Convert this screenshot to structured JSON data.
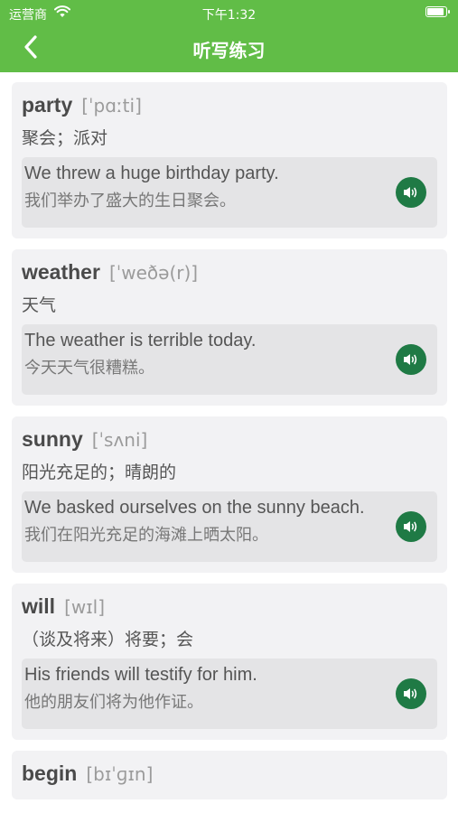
{
  "status": {
    "carrier": "运营商",
    "time": "下午1:32"
  },
  "header": {
    "title": "听写练习"
  },
  "words": [
    {
      "word": "party",
      "phonetic": "[ˈpɑːti]",
      "meaning": "聚会；派对",
      "example_en": "We threw a huge birthday party.",
      "example_zh": "我们举办了盛大的生日聚会。"
    },
    {
      "word": "weather",
      "phonetic": "[ˈweðə(r)]",
      "meaning": "天气",
      "example_en": "The weather is terrible today.",
      "example_zh": "今天天气很糟糕。"
    },
    {
      "word": "sunny",
      "phonetic": "[ˈsʌni]",
      "meaning": "阳光充足的；晴朗的",
      "example_en": "We basked ourselves on the sunny beach.",
      "example_zh": "我们在阳光充足的海滩上晒太阳。"
    },
    {
      "word": "will",
      "phonetic": "[wɪl]",
      "meaning": "（谈及将来）将要；会",
      "example_en": "His friends will testify for him.",
      "example_zh": "他的朋友们将为他作证。"
    },
    {
      "word": "begin",
      "phonetic": "[bɪˈɡɪn]",
      "meaning": "",
      "example_en": "",
      "example_zh": ""
    }
  ],
  "colors": {
    "header": "#61bd47",
    "speaker": "#1f7a45",
    "card": "#f2f2f4",
    "example": "#e4e4e6"
  },
  "icons": {
    "back": "chevron-left-icon",
    "speaker": "speaker-icon",
    "wifi": "wifi-icon",
    "battery": "battery-icon"
  }
}
